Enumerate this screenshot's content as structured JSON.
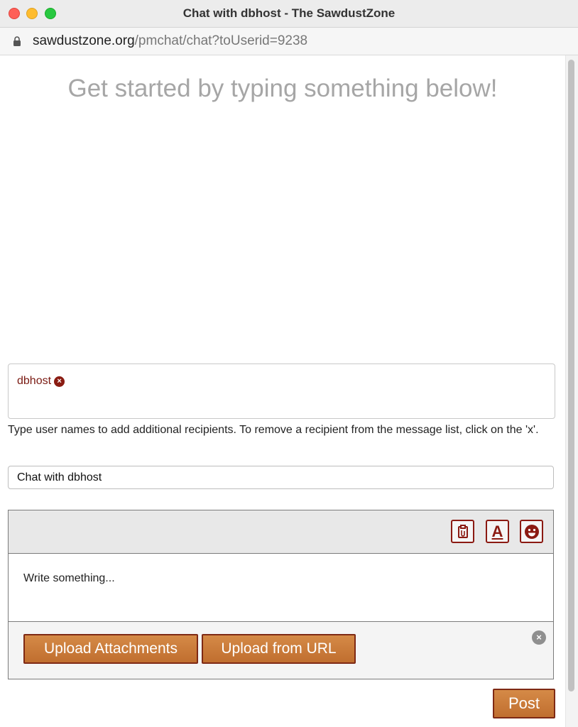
{
  "window": {
    "title": "Chat with dbhost - The SawdustZone"
  },
  "browser": {
    "url_domain": "sawdustzone.org",
    "url_path": "/pmchat/chat?toUserid=9238",
    "lock_icon": "lock-icon"
  },
  "chat": {
    "empty_message": "Get started by typing something below!"
  },
  "recipients": {
    "items": [
      {
        "name": "dbhost",
        "remove_icon": "remove-circle-icon",
        "remove_glyph": "×"
      }
    ],
    "help_text": "Type user names to add additional recipients. To remove a recipient from the message list, click on the 'x'."
  },
  "subject": {
    "value": "Chat with dbhost"
  },
  "editor": {
    "toolbar": {
      "attach_icon": "attachment-icon",
      "font_label": "A",
      "font_icon": "font-style-icon",
      "smiley_icon": "smiley-icon"
    },
    "placeholder": "Write something...",
    "upload": {
      "attachments_label": "Upload Attachments",
      "url_label": "Upload from URL",
      "close_icon": "close-circle-icon",
      "close_glyph": "×"
    }
  },
  "actions": {
    "post_label": "Post"
  },
  "colors": {
    "accent": "#8b1a12",
    "button_bg": "#c87936",
    "placeholder_text": "#a6a6a6"
  }
}
